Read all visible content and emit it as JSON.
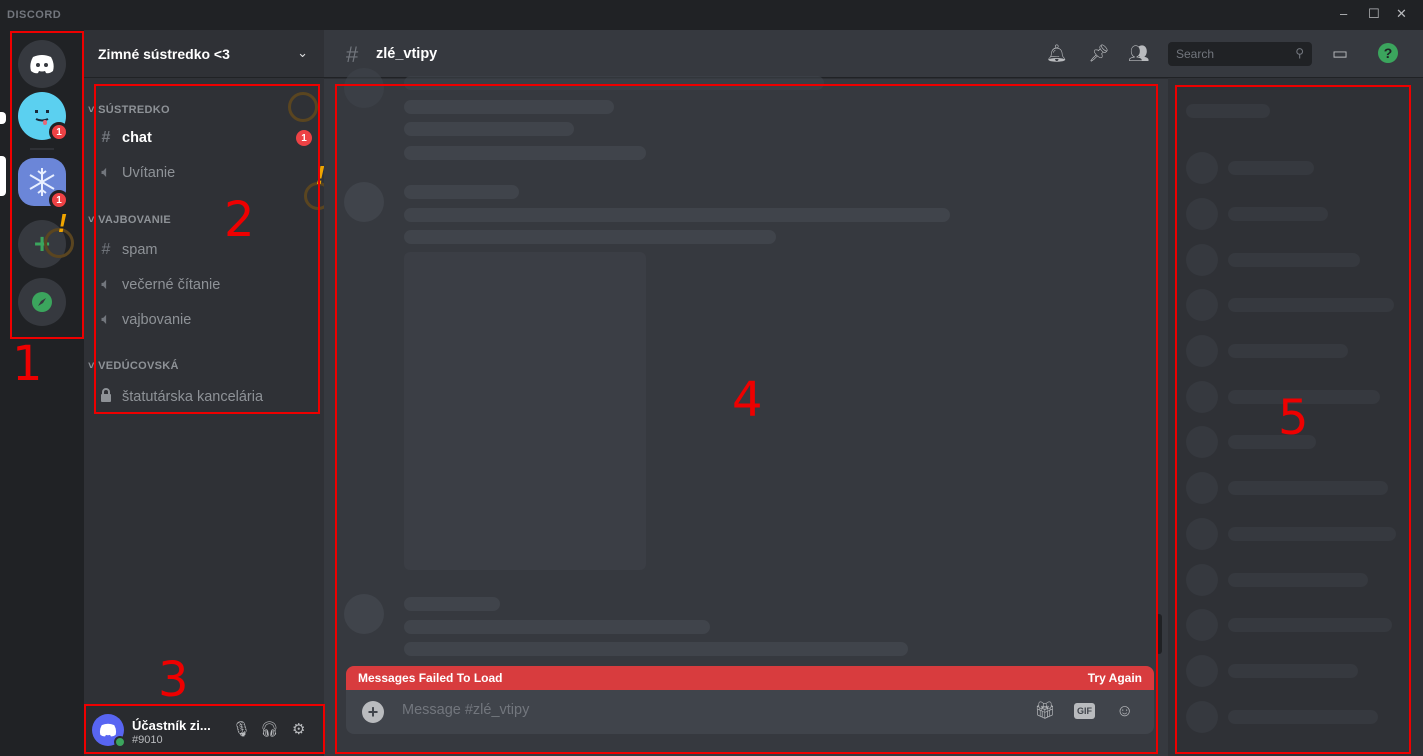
{
  "titlebar": {
    "brand": "DISCORD",
    "minimize": "–",
    "maximize": "☐",
    "close": "✕"
  },
  "servers": [
    {
      "name": "home",
      "badge": ""
    },
    {
      "name": "server-smiley",
      "badge": "1"
    },
    {
      "name": "server-snowflake",
      "badge": "1"
    },
    {
      "name": "add-server",
      "badge": ""
    },
    {
      "name": "explore",
      "badge": ""
    }
  ],
  "guild": {
    "name": "Zimné sústredko <3",
    "chevron": "⌄"
  },
  "categories": [
    {
      "label": "SÚSTREDKO",
      "channels": [
        {
          "name": "chat",
          "type": "text",
          "badge": "1"
        },
        {
          "name": "Uvítanie",
          "type": "voice"
        }
      ]
    },
    {
      "label": "VAJBOVANIE",
      "channels": [
        {
          "name": "spam",
          "type": "text"
        },
        {
          "name": "večerné čítanie",
          "type": "voice"
        },
        {
          "name": "vajbovanie",
          "type": "voice"
        }
      ]
    },
    {
      "label": "VEDÚCOVSKÁ",
      "channels": [
        {
          "name": "štatutárska kancelária",
          "type": "locked"
        }
      ]
    }
  ],
  "user": {
    "name": "Účastník zi...",
    "tag": "#9010"
  },
  "channel": {
    "name": "zlé_vtipy",
    "search_placeholder": "Search"
  },
  "error": {
    "message": "Messages Failed To Load",
    "retry": "Try Again"
  },
  "composer": {
    "placeholder": "Message #zlé_vtipy",
    "gif": "GIF"
  },
  "annotations": [
    "1",
    "2",
    "3",
    "4",
    "5"
  ],
  "colors": {
    "accent": "#5865f2",
    "danger": "#ed4245",
    "error_bar": "#d83c3e",
    "online": "#3ba55d",
    "annotation": "#ee0000"
  }
}
